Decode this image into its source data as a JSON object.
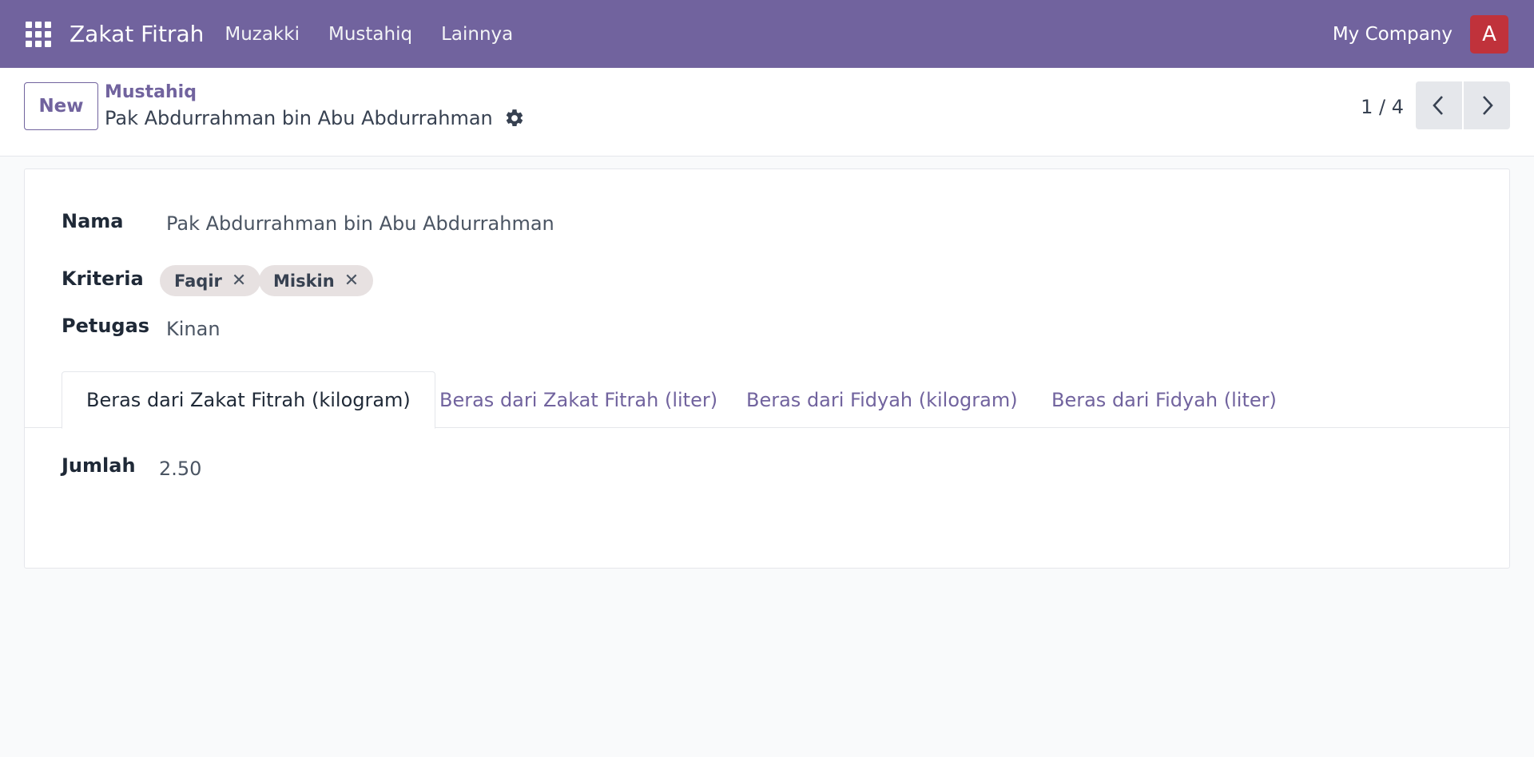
{
  "navbar": {
    "app_title": "Zakat Fitrah",
    "menu": [
      "Muzakki",
      "Mustahiq",
      "Lainnya"
    ],
    "company": "My Company",
    "avatar_letter": "A",
    "bg_color": "#71639e",
    "avatar_color": "#c0323b"
  },
  "control_panel": {
    "new_button": "New",
    "breadcrumb_parent": "Mustahiq",
    "breadcrumb_current": "Pak Abdurrahman bin Abu Abdurrahman",
    "pager": "1 / 4"
  },
  "form": {
    "nama_label": "Nama",
    "nama_value": "Pak Abdurrahman bin Abu Abdurrahman",
    "kriteria_label": "Kriteria",
    "kriteria_tags": [
      "Faqir",
      "Miskin"
    ],
    "petugas_label": "Petugas",
    "petugas_value": "Kinan",
    "tabs": [
      "Beras dari Zakat Fitrah (kilogram)",
      "Beras dari Zakat Fitrah (liter)",
      "Beras dari Fidyah (kilogram)",
      "Beras dari Fidyah (liter)"
    ],
    "active_tab": 0,
    "jumlah_label": "Jumlah",
    "jumlah_value": "2.50"
  },
  "icons": {
    "apps": "apps-grid-icon",
    "settings": "gear-icon",
    "prev": "chevron-left-icon",
    "next": "chevron-right-icon",
    "remove": "close-icon"
  }
}
